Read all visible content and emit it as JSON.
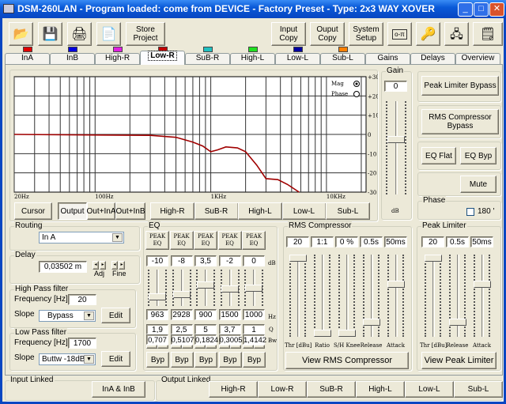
{
  "title": "DSM-260LAN - Program loaded: come from DEVICE - Factory Preset - Type: 2x3 WAY XOVER",
  "toolbar": {
    "icons": [
      "open-folder-icon",
      "save-disk-icon",
      "print-icon",
      "print-preview-icon"
    ],
    "store_project": "Store\nProject",
    "input_copy": "Input\nCopy",
    "output_copy": "Ouput\nCopy",
    "system_setup": "System\nSetup",
    "extra_icons": [
      "password-key-button",
      "keys-icon",
      "usb-device-icon",
      "notes-icon"
    ]
  },
  "tabs": [
    {
      "label": "InA",
      "color": "#e00000"
    },
    {
      "label": "InB",
      "color": "#0000e0"
    },
    {
      "label": "High-R",
      "color": "#e020e0"
    },
    {
      "label": "Low-R",
      "color": "#c00000",
      "selected": true
    },
    {
      "label": "SuB-R",
      "color": "#20c0c0"
    },
    {
      "label": "High-L",
      "color": "#20e020"
    },
    {
      "label": "Low-L",
      "color": "#0000a0"
    },
    {
      "label": "Sub-L",
      "color": "#ff8000"
    },
    {
      "label": "Gains"
    },
    {
      "label": "Delays"
    },
    {
      "label": "Overview"
    }
  ],
  "graph": {
    "mag_label": "Mag",
    "phase_label": "Phase",
    "mode": "Mag",
    "x_ticks": [
      "20Hz",
      "100Hz",
      "1KHz",
      "10KHz"
    ],
    "y_ticks": [
      "+30",
      "+20",
      "+10",
      "0",
      "-10",
      "-20",
      "-30"
    ],
    "curve_color": "#a00000",
    "chart_data": {
      "type": "line",
      "x_scale": "log",
      "xlim": [
        20,
        22000
      ],
      "ylim": [
        -30,
        30
      ],
      "grid": true,
      "points": [
        [
          20,
          0
        ],
        [
          300,
          -0.5
        ],
        [
          500,
          -1.5
        ],
        [
          700,
          -4
        ],
        [
          850,
          -6
        ],
        [
          1000,
          -9
        ],
        [
          1150,
          -8
        ],
        [
          1350,
          -6.5
        ],
        [
          1700,
          -7
        ],
        [
          2000,
          -9
        ],
        [
          2500,
          -16
        ],
        [
          3000,
          -23
        ],
        [
          3800,
          -23.5
        ],
        [
          4600,
          -26
        ],
        [
          5800,
          -30
        ]
      ]
    }
  },
  "graph_buttons": {
    "cursor": "Cursor",
    "output": "Output",
    "out_ina": "Out+InA",
    "out_inb": "Out+InB",
    "channels": [
      "High-R",
      "SuB-R",
      "High-L",
      "Low-L",
      "Sub-L"
    ]
  },
  "gain": {
    "title": "Gain",
    "value": "0",
    "unit": "dB",
    "level": 0.6
  },
  "right": {
    "peak_bypass": "Peak Limiter Bypass",
    "rms_bypass": "RMS Compressor\nBypass",
    "eq_flat": "EQ Flat",
    "eq_byp": "EQ Byp",
    "mute": "Mute",
    "phase_title": "Phase",
    "phase_180": "180 '",
    "phase_checked": false
  },
  "routing": {
    "title": "Routing",
    "value": "In A"
  },
  "delay": {
    "title": "Delay",
    "value": "0,03502 m",
    "adj": "Adj",
    "fine": "Fine"
  },
  "hpf": {
    "title": "High Pass filter",
    "freq_label": "Frequency [Hz]",
    "freq": "20",
    "slope_label": "Slope",
    "slope": "Bypass",
    "edit": "Edit"
  },
  "lpf": {
    "title": "Low Pass filter",
    "freq_label": "Frequency [Hz]",
    "freq": "1700",
    "slope_label": "Slope",
    "slope": "Buttw -18dB",
    "edit": "Edit"
  },
  "eq": {
    "title": "EQ",
    "db_unit": "dB",
    "hz_unit": "Hz",
    "q_unit": "Q",
    "bw_unit": "Bw",
    "bands": [
      {
        "type": "PEAK\nEQ",
        "gain": "-10",
        "freq": "963",
        "q": "1,9",
        "bw": "0,707",
        "byp": "Byp",
        "level": 0.2
      },
      {
        "type": "PEAK\nEQ",
        "gain": "-8",
        "freq": "2928",
        "q": "2,5",
        "bw": "0,5107",
        "byp": "Byp",
        "level": 0.27
      },
      {
        "type": "PEAK\nEQ",
        "gain": "3,5",
        "freq": "900",
        "q": "5",
        "bw": "0,1824",
        "byp": "Byp",
        "level": 0.6
      },
      {
        "type": "PEAK\nEQ",
        "gain": "-2",
        "freq": "1500",
        "q": "3,7",
        "bw": "0,3005",
        "byp": "Byp",
        "level": 0.45
      },
      {
        "type": "PEAK\nEQ",
        "gain": "0",
        "freq": "1000",
        "q": "1",
        "bw": "1,4142",
        "byp": "Byp",
        "level": 0.5
      }
    ]
  },
  "rms": {
    "title": "RMS Compressor",
    "view": "View RMS Compressor",
    "params": [
      {
        "label": "Thr [dBu]",
        "value": "20",
        "level": 1.0
      },
      {
        "label": "Ratio",
        "value": "1:1",
        "level": 0.0
      },
      {
        "label": "S/H Knee",
        "value": "0 %",
        "level": 0.0
      },
      {
        "label": "Release",
        "value": "0.5s",
        "level": 0.15
      },
      {
        "label": "Attack",
        "value": "50ms",
        "level": 0.65
      }
    ]
  },
  "limiter": {
    "title": "Peak Limiter",
    "view": "View Peak Limiter",
    "params": [
      {
        "label": "Thr [dBu]",
        "value": "20",
        "level": 1.0
      },
      {
        "label": "Release",
        "value": "0.5s",
        "level": 0.15
      },
      {
        "label": "Attack",
        "value": "50ms",
        "level": 0.65
      }
    ]
  },
  "input_linked": {
    "title": "Input Linked",
    "button": "InA & InB"
  },
  "output_linked": {
    "title": "Output Linked",
    "buttons": [
      "High-R",
      "Low-R",
      "SuB-R",
      "High-L",
      "Low-L",
      "Sub-L"
    ]
  }
}
